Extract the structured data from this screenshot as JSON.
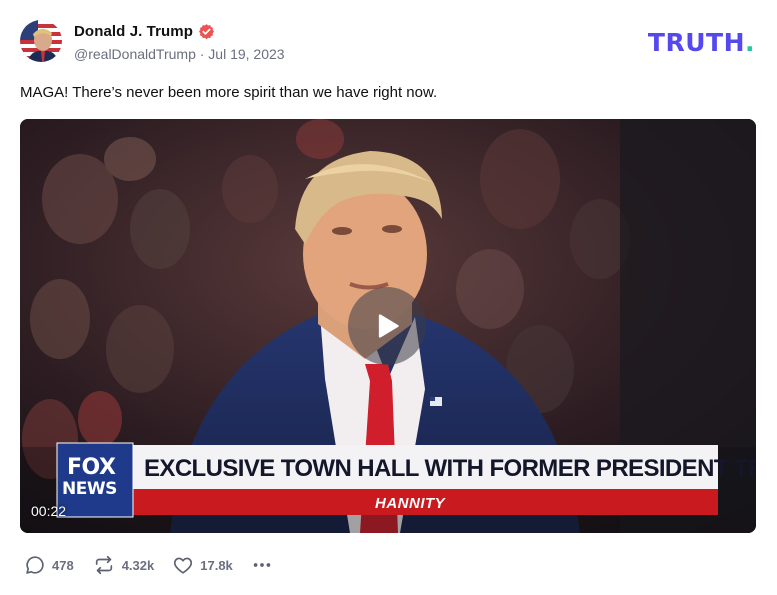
{
  "post": {
    "author_name": "Donald J. Trump",
    "handle_date": "@realDonaldTrump · Jul 19, 2023",
    "text": "MAGA! There’s never been more spirit than we have right now."
  },
  "brand": {
    "logo_text": "TRUTH",
    "logo_dot": ".",
    "logo_color": "#5448ee",
    "dot_color": "#22c7a3"
  },
  "video": {
    "duration": "00:22",
    "lower_third_headline": "EXCLUSIVE TOWN HALL WITH FORMER PRESIDENT TRUMP",
    "lower_third_show": "HANNITY",
    "network_logo_line1": "FOX",
    "network_logo_line2": "NEWS"
  },
  "actions": {
    "replies": "478",
    "retruths": "4.32k",
    "likes": "17.8k"
  },
  "icons": [
    "verified-badge-icon",
    "play-icon",
    "reply-icon",
    "retruth-icon",
    "like-icon",
    "more-icon"
  ]
}
